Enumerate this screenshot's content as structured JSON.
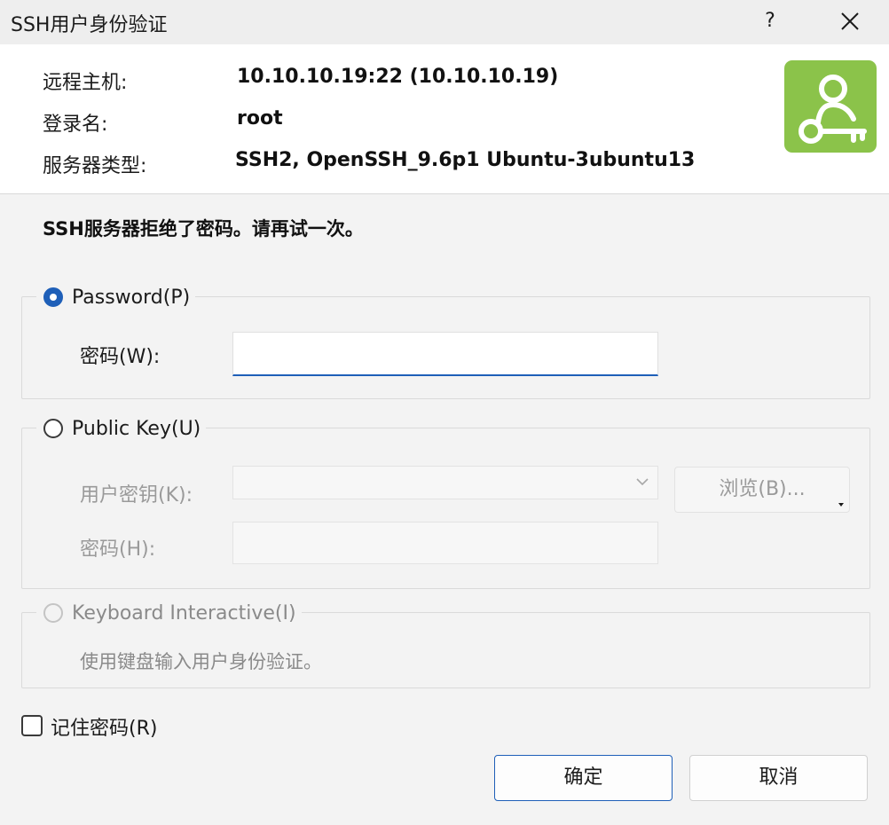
{
  "window": {
    "title": "SSH用户身份验证",
    "help_label": "?"
  },
  "info": {
    "host_label": "远程主机:",
    "host_value": "10.10.10.19:22 (10.10.10.19)",
    "login_label": "登录名:",
    "login_value": "root",
    "server_type_label": "服务器类型:",
    "server_type_value": "SSH2, OpenSSH_9.6p1 Ubuntu-3ubuntu13",
    "logo_icon": "user-key-icon",
    "logo_color": "#8bc34a"
  },
  "error_message": "SSH服务器拒绝了密码。请再试一次。",
  "password_group": {
    "option_label": "Password(P)",
    "selected": true,
    "password_label": "密码(W):",
    "password_value": ""
  },
  "pubkey_group": {
    "option_label": "Public Key(U)",
    "selected": false,
    "user_key_label": "用户密钥(K):",
    "user_key_value": "",
    "browse_label": "浏览(B)...",
    "passphrase_label": "密码(H):",
    "passphrase_value": ""
  },
  "keyboard_group": {
    "option_label": "Keyboard Interactive(I)",
    "selected": false,
    "description": "使用键盘输入用户身份验证。"
  },
  "remember_password": {
    "label": "记住密码(R)",
    "checked": false
  },
  "buttons": {
    "ok_label": "确定",
    "cancel_label": "取消"
  },
  "colors": {
    "accent": "#1e5fb8",
    "logo": "#8bc34a"
  }
}
